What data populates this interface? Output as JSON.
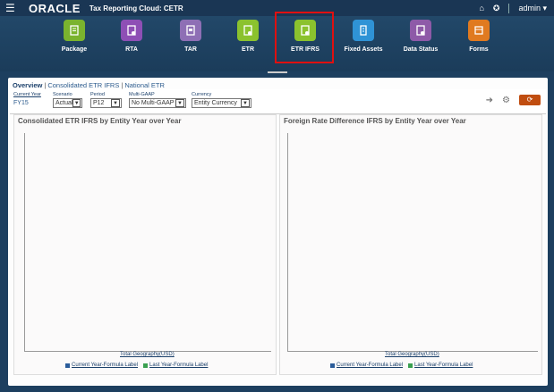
{
  "topbar": {
    "logo": "ORACLE",
    "app_title": "Tax Reporting Cloud: CETR",
    "user": "admin"
  },
  "nav": {
    "items": [
      {
        "label": "Package",
        "color": "#7ab32e"
      },
      {
        "label": "RTA",
        "color": "#8e4fb5"
      },
      {
        "label": "TAR",
        "color": "#8e6fb5"
      },
      {
        "label": "ETR",
        "color": "#8bc22e"
      },
      {
        "label": "ETR IFRS",
        "color": "#8bc22e"
      },
      {
        "label": "Fixed Assets",
        "color": "#2f93d6"
      },
      {
        "label": "Data Status",
        "color": "#8e5aa8"
      },
      {
        "label": "Forms",
        "color": "#e07a20"
      }
    ],
    "selected": "ETR IFRS"
  },
  "tabs": {
    "overview": "Overview",
    "consolidated": "Consolidated ETR IFRS",
    "national": "National ETR"
  },
  "pov": {
    "current_year_label": "Current Year",
    "current_year_value": "FY15",
    "scenario_label": "Scenario",
    "scenario_value": "Actual",
    "period_label": "Period",
    "period_value": "P12",
    "multigaap_label": "Multi-GAAP",
    "multigaap_value": "No Multi-GAAP",
    "currency_label": "Currency",
    "currency_value": "Entity Currency"
  },
  "charts": [
    {
      "title": "Consolidated ETR IFRS by Entity Year over Year",
      "xlabel": "Total Geography(USD)",
      "legend": [
        "Current Year-Formula Label",
        "Last Year-Formula Label"
      ]
    },
    {
      "title": "Foreign Rate Difference IFRS by Entity Year over Year",
      "xlabel": "Total Geography(USD)",
      "legend": [
        "Current Year-Formula Label",
        "Last Year-Formula Label"
      ]
    }
  ],
  "colors": {
    "series_current": "#2a5c9a",
    "series_last": "#3aa050",
    "selection_border": "#e01010",
    "refresh_button": "#c04d10"
  }
}
